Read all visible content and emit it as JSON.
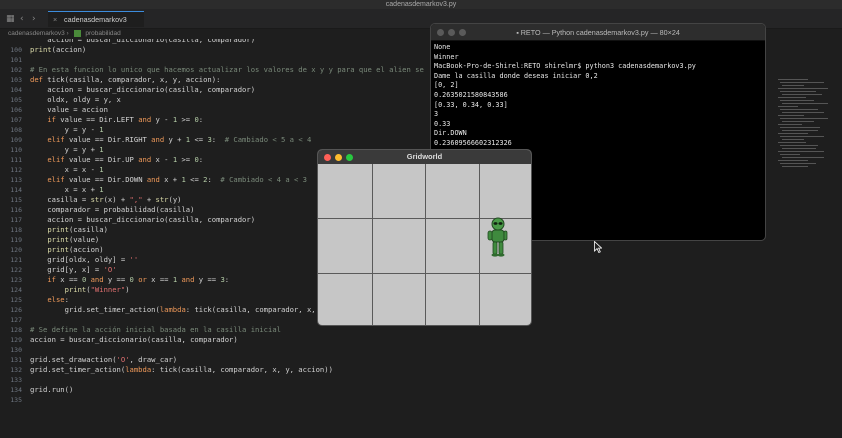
{
  "window_title": "cadenasdemarkov3.py",
  "tab": {
    "label": "cadenasdemarkov3"
  },
  "breadcrumb": {
    "path": "cadenasdemarkov3",
    "symbol": "probabilidad"
  },
  "code": [
    {
      "n": "",
      "t": "    accion = buscar_diccionario(casilla, comparador)"
    },
    {
      "n": "100",
      "t": "print(accion)"
    },
    {
      "n": "101",
      "t": ""
    },
    {
      "n": "102",
      "t": "# En esta funcion lo unico que hacemos actualizar los valores de x y y para que el alien se"
    },
    {
      "n": "103",
      "t": "def tick(casilla, comparador, x, y, accion):"
    },
    {
      "n": "104",
      "t": "    accion = buscar_diccionario(casilla, comparador)"
    },
    {
      "n": "105",
      "t": "    oldx, oldy = y, x"
    },
    {
      "n": "106",
      "t": "    value = accion"
    },
    {
      "n": "107",
      "t": "    if value == Dir.LEFT and y - 1 >= 0:"
    },
    {
      "n": "108",
      "t": "        y = y - 1"
    },
    {
      "n": "109",
      "t": "    elif value == Dir.RIGHT and y + 1 <= 3:  # Cambiado < 5 a < 4"
    },
    {
      "n": "110",
      "t": "        y = y + 1"
    },
    {
      "n": "111",
      "t": "    elif value == Dir.UP and x - 1 >= 0:"
    },
    {
      "n": "112",
      "t": "        x = x - 1"
    },
    {
      "n": "113",
      "t": "    elif value == Dir.DOWN and x + 1 <= 2:  # Cambiado < 4 a < 3"
    },
    {
      "n": "114",
      "t": "        x = x + 1"
    },
    {
      "n": "115",
      "t": "    casilla = str(x) + \",\" + str(y)"
    },
    {
      "n": "116",
      "t": "    comparador = probabilidad(casilla)"
    },
    {
      "n": "117",
      "t": "    accion = buscar_diccionario(casilla, comparador)"
    },
    {
      "n": "118",
      "t": "    print(casilla)"
    },
    {
      "n": "119",
      "t": "    print(value)"
    },
    {
      "n": "120",
      "t": "    print(accion)"
    },
    {
      "n": "121",
      "t": "    grid[oldx, oldy] = ''"
    },
    {
      "n": "122",
      "t": "    grid[y, x] = 'O'"
    },
    {
      "n": "123",
      "t": "    if x == 0 and y == 0 or x == 1 and y == 3:"
    },
    {
      "n": "124",
      "t": "        print(\"Winner\")"
    },
    {
      "n": "125",
      "t": "    else:"
    },
    {
      "n": "126",
      "t": "        grid.set_timer_action(lambda: tick(casilla, comparador, x,"
    },
    {
      "n": "127",
      "t": ""
    },
    {
      "n": "128",
      "t": "# Se define la acción inicial basada en la casilla inicial"
    },
    {
      "n": "129",
      "t": "accion = buscar_diccionario(casilla, comparador)"
    },
    {
      "n": "130",
      "t": ""
    },
    {
      "n": "131",
      "t": "grid.set_drawaction('O', draw_car)"
    },
    {
      "n": "132",
      "t": "grid.set_timer_action(lambda: tick(casilla, comparador, x, y, accion))"
    },
    {
      "n": "133",
      "t": ""
    },
    {
      "n": "134",
      "t": "grid.run()"
    },
    {
      "n": "135",
      "t": ""
    }
  ],
  "terminal": {
    "title": "RETO — Python cadenasdemarkov3.py — 80×24",
    "lines": [
      "None",
      "Winner",
      "MacBook-Pro-de-Shirel:RETO shirelmr$ python3 cadenasdemarkov3.py",
      "Dame la casilla donde deseas iniciar 0,2",
      "[0, 2]",
      "0.2635021580843586",
      "[0.33, 0.34, 0.33]",
      "3",
      "0.33",
      "Dir.DOWN",
      "0.23609566602312326",
      "[1]",
      "1"
    ]
  },
  "gridworld": {
    "title": "Gridworld",
    "cols": 4,
    "rows": 3,
    "agent": {
      "row": 1,
      "col": 3
    }
  },
  "colors": {
    "keyword": "#f09a5a",
    "function": "#dcdcaa",
    "string": "#e07070",
    "comment": "#7a8a7a",
    "accent": "#3c8cdc"
  }
}
